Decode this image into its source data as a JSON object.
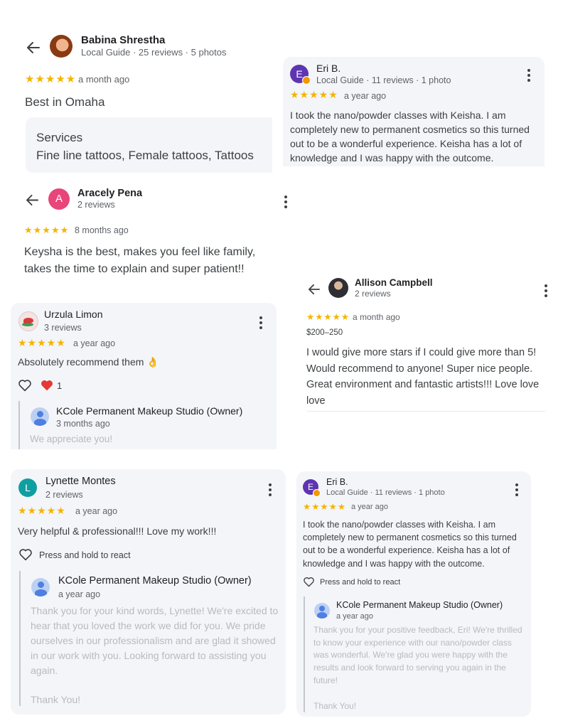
{
  "r1": {
    "name": "Babina Shrestha",
    "meta": "Local Guide · 25 reviews · 5 photos",
    "stars": "★★★★★",
    "time": "a month ago",
    "text": "Best in Omaha",
    "services_title": "Services",
    "services_text": "Fine line tattoos, Female tattoos, Tattoos"
  },
  "r2": {
    "initial": "E",
    "name": "Eri B.",
    "meta": "Local Guide · 11 reviews · 1 photo",
    "stars": "★★★★★",
    "time": "a year ago",
    "text": "I took the nano/powder classes with Keisha. I am completely new to permanent cosmetics so this turned out to be a wonderful experience. Keisha has a lot of knowledge and I was happy with the outcome."
  },
  "r3": {
    "initial": "A",
    "name": "Aracely Pena",
    "meta": "2 reviews",
    "stars": "★★★★★",
    "time": "8 months ago",
    "text": "Keysha is the best, makes you feel like family, takes the time to explain and super patient!!"
  },
  "r4": {
    "name": "Allison Campbell",
    "meta": "2 reviews",
    "stars": "★★★★★",
    "time": "a month ago",
    "price": "$200–250",
    "text": "I would give more stars if I could give more than 5! Would recommend to anyone! Super nice people. Great environment and fantastic artists!!! Love love love"
  },
  "r5": {
    "name": "Urzula Limon",
    "meta": "3 reviews",
    "stars": "★★★★★",
    "time": "a year ago",
    "text": "Absolutely recommend them 👌",
    "heart_count": "1",
    "owner_name": "KCole Permanent Makeup Studio (Owner)",
    "owner_time": "3 months ago",
    "owner_text": "We appreciate you!"
  },
  "r6": {
    "initial": "L",
    "name": "Lynette Montes",
    "meta": "2 reviews",
    "stars": "★★★★★",
    "time": "a year ago",
    "text": "Very helpful & professional!!! Love my work!!!",
    "react_label": "Press and hold to react",
    "owner_name": "KCole Permanent Makeup Studio (Owner)",
    "owner_time": "a year ago",
    "owner_text": "Thank you for your kind words, Lynette! We're excited to hear that you loved the work we did for you. We pride ourselves in our professionalism and are glad it showed in our work with you. Looking forward to assisting you again.",
    "owner_signoff": "Thank You!"
  },
  "r7": {
    "initial": "E",
    "name": "Eri B.",
    "meta": "Local Guide · 11 reviews · 1 photo",
    "stars": "★★★★★",
    "time": "a year ago",
    "text": "I took the nano/powder classes with Keisha. I am completely new to permanent cosmetics so this turned out to be a wonderful experience. Keisha has a lot of knowledge and I was happy with the outcome.",
    "react_label": "Press and hold to react",
    "owner_name": "KCole Permanent Makeup Studio (Owner)",
    "owner_time": "a year ago",
    "owner_text": "Thank you for your positive feedback, Eri! We're thrilled to know your experience with our nano/powder class was wonderful. We're glad you were happy with the results and look forward to serving you again in the future!",
    "owner_signoff": "Thank You!"
  },
  "colors": {
    "star": "#f4b400",
    "purple_avatar": "#5e35b1",
    "pink_avatar": "#e8457a",
    "teal_avatar": "#0f9fa0",
    "card_bg": "#f4f5f8"
  }
}
